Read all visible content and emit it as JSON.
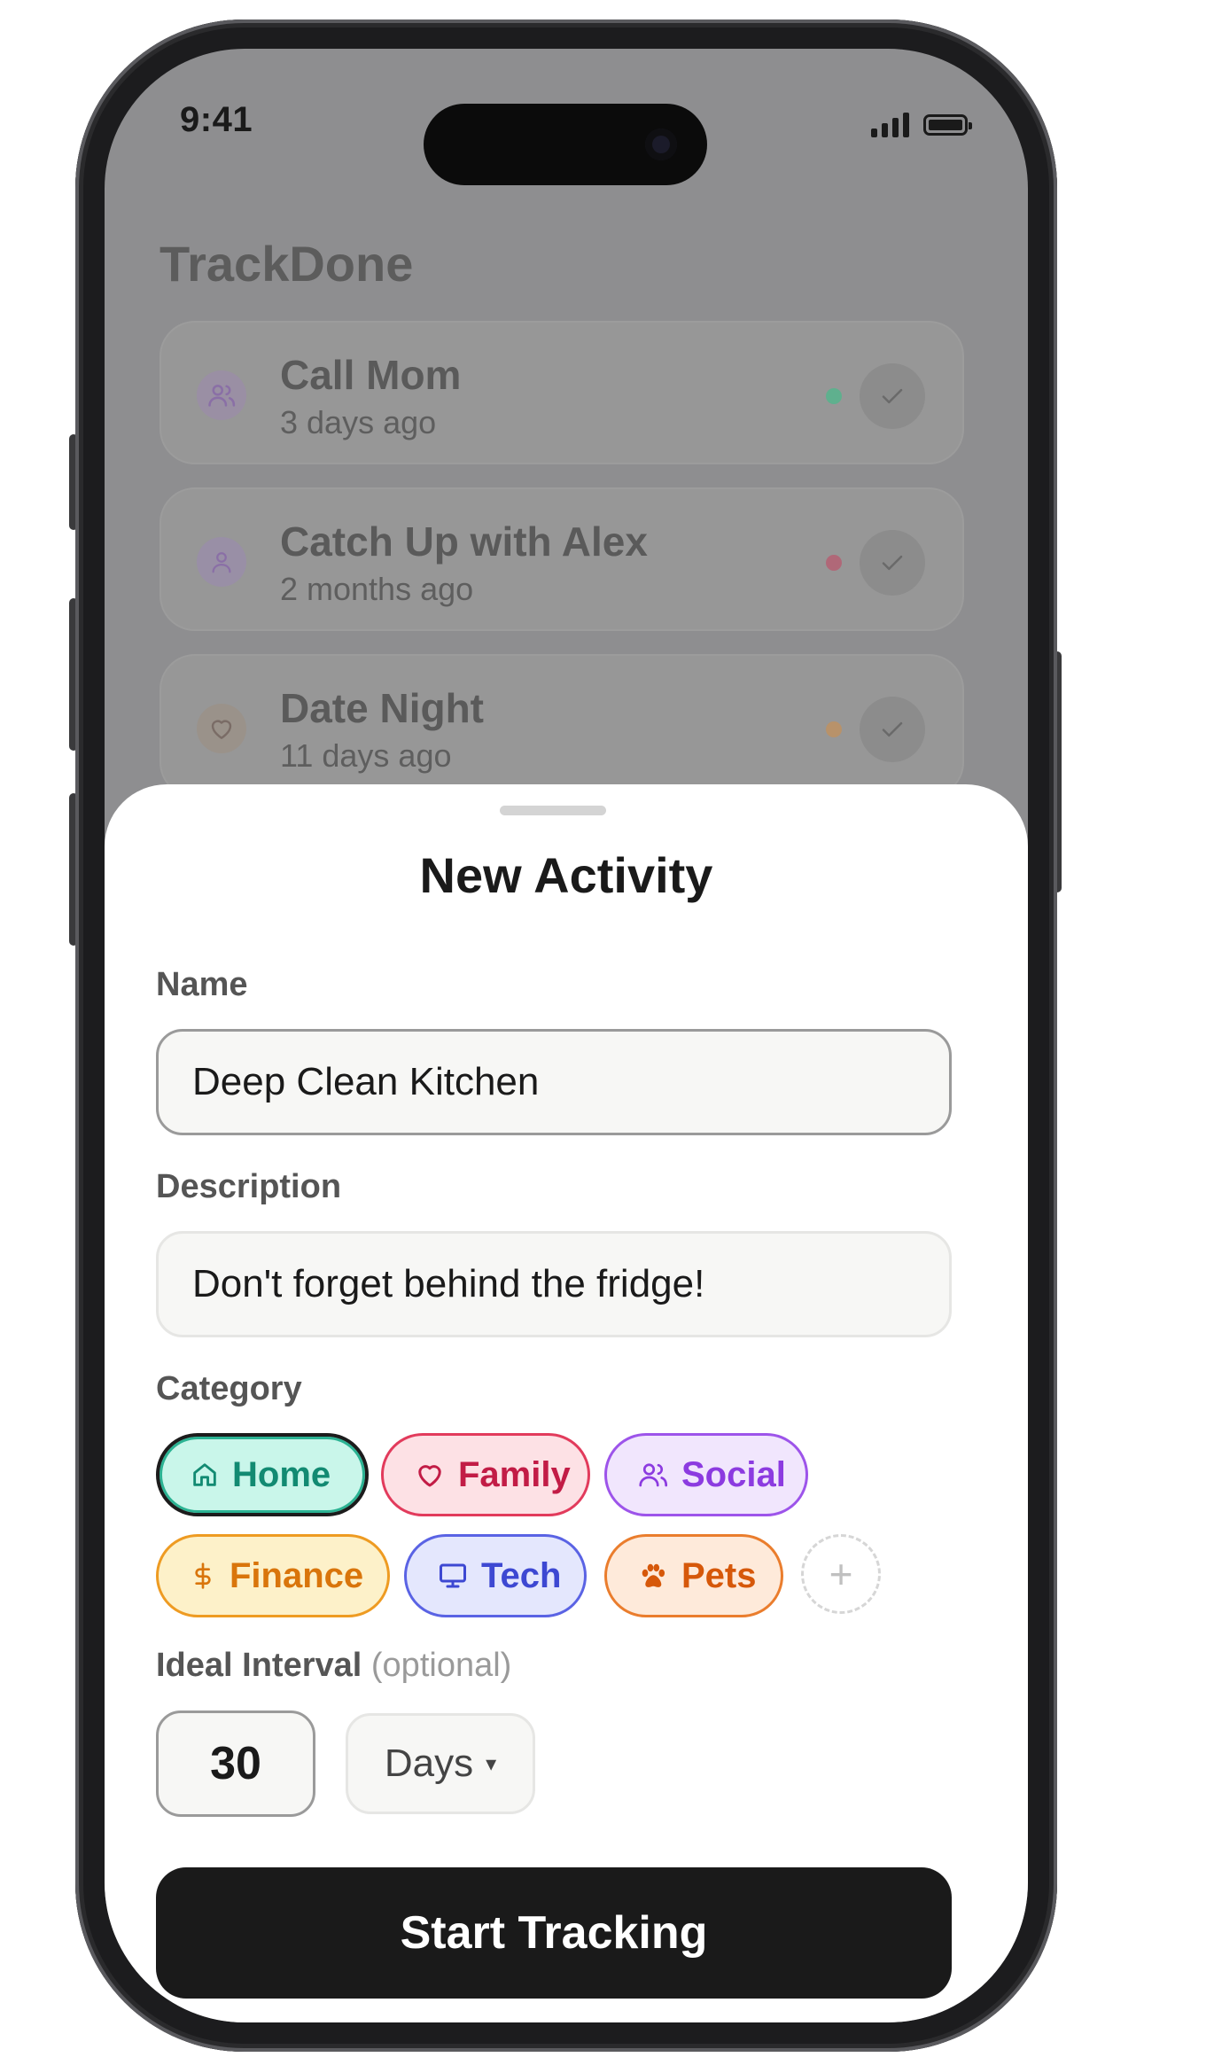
{
  "status": {
    "time": "9:41"
  },
  "app": {
    "title": "TrackDone"
  },
  "activities": [
    {
      "title": "Call Mom",
      "subtitle": "3 days ago",
      "icon": "users-icon",
      "status_color": "#5fb08e"
    },
    {
      "title": "Catch Up with Alex",
      "subtitle": "2 months ago",
      "icon": "user-icon",
      "status_color": "#b06878"
    },
    {
      "title": "Date Night",
      "subtitle": "11 days ago",
      "icon": "heart-icon",
      "status_color": "#b8926a"
    }
  ],
  "sheet": {
    "title": "New Activity",
    "name_label": "Name",
    "name_value": "Deep Clean Kitchen",
    "description_label": "Description",
    "description_value": "Don't forget behind the fridge!",
    "category_label": "Category",
    "categories": [
      {
        "label": "Home",
        "icon": "home-icon",
        "selected": true,
        "color": "#128a72"
      },
      {
        "label": "Family",
        "icon": "heart-icon",
        "selected": false,
        "color": "#c21c46"
      },
      {
        "label": "Social",
        "icon": "users-icon",
        "selected": false,
        "color": "#8c3be0"
      },
      {
        "label": "Finance",
        "icon": "dollar-icon",
        "selected": false,
        "color": "#d9750b"
      },
      {
        "label": "Tech",
        "icon": "monitor-icon",
        "selected": false,
        "color": "#3d48d2"
      },
      {
        "label": "Pets",
        "icon": "paw-icon",
        "selected": false,
        "color": "#d6580a"
      }
    ],
    "add_category": "+",
    "interval_label": "Ideal Interval",
    "interval_optional": "(optional)",
    "interval_value": "30",
    "interval_unit": "Days",
    "interval_caret": "▾",
    "submit_label": "Start Tracking"
  }
}
